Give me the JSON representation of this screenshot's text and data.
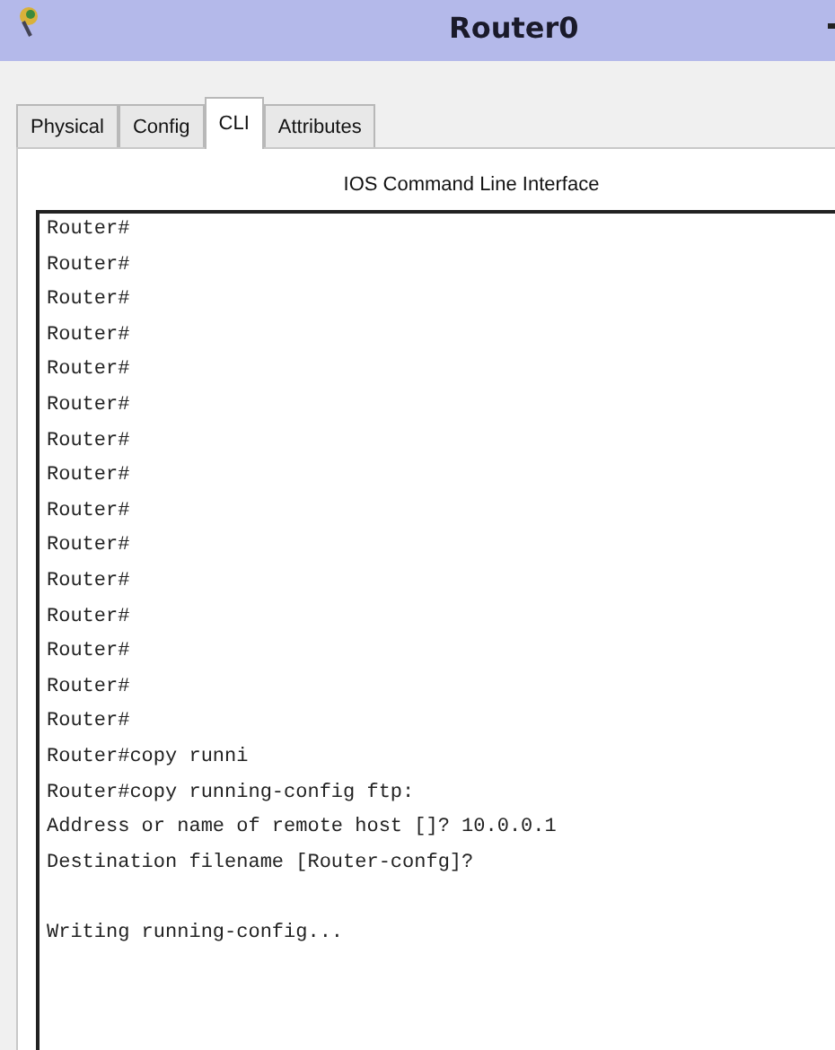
{
  "window": {
    "title": "Router0"
  },
  "tabs": [
    {
      "label": "Physical",
      "selected": false
    },
    {
      "label": "Config",
      "selected": false
    },
    {
      "label": "CLI",
      "selected": true
    },
    {
      "label": "Attributes",
      "selected": false
    }
  ],
  "panel": {
    "heading": "IOS Command Line Interface"
  },
  "console": {
    "lines": [
      "Router#",
      "Router#",
      "Router#",
      "Router#",
      "Router#",
      "Router#",
      "Router#",
      "Router#",
      "Router#",
      "Router#",
      "Router#",
      "Router#",
      "Router#",
      "Router#",
      "Router#",
      "Router#copy runni",
      "Router#copy running-config ftp:",
      "Address or name of remote host []? 10.0.0.1",
      "Destination filename [Router-confg]?"
    ],
    "output": [
      "Writing running-config..."
    ]
  }
}
